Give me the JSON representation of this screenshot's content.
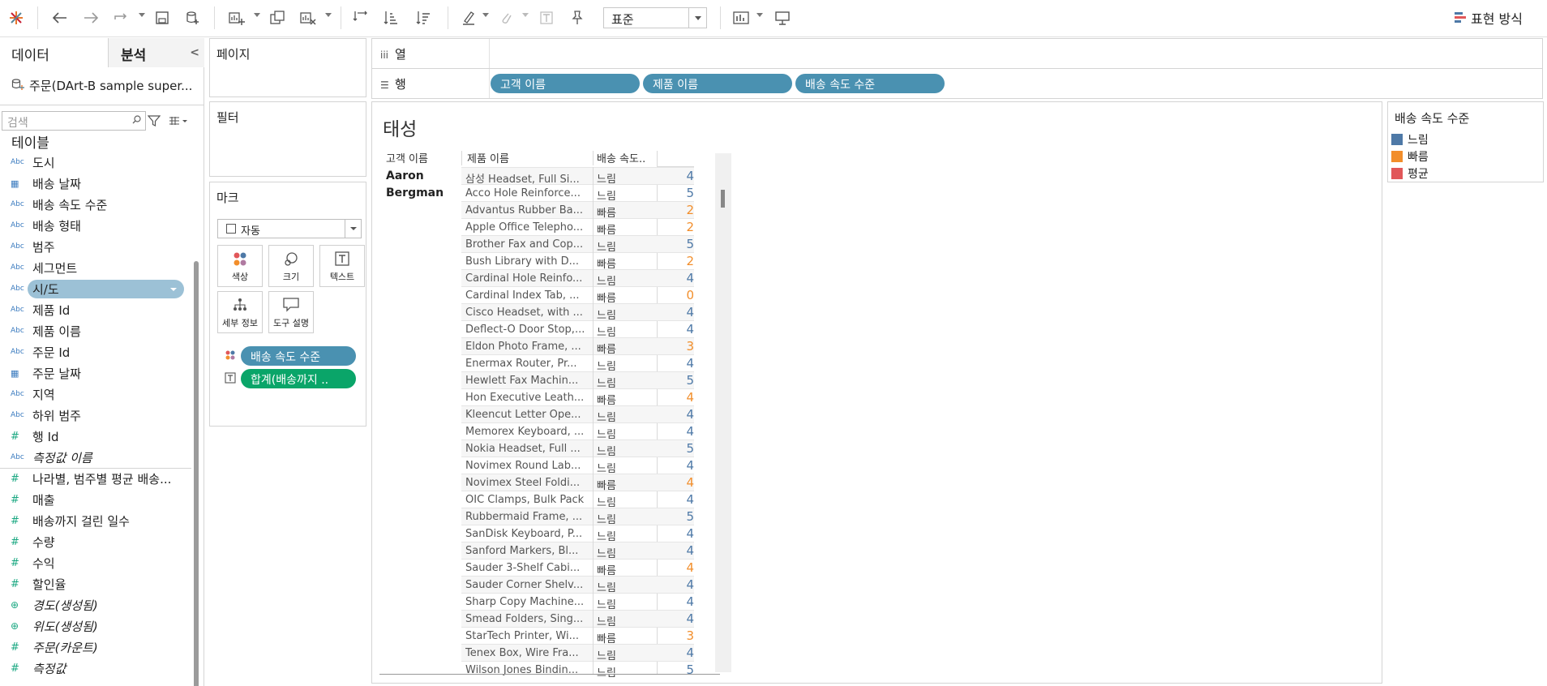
{
  "toolbar": {
    "fit_value": "표준",
    "show_me_label": "표현 방식"
  },
  "data_pane": {
    "tab_data": "데이터",
    "tab_analytics": "분석",
    "datasource_name": "주문(DArt-B sample super...",
    "search_placeholder": "검색",
    "tables_heading": "테이블",
    "fields": [
      {
        "type": "Abc",
        "name": "도시"
      },
      {
        "type": "cal",
        "name": "배송 날짜"
      },
      {
        "type": "Abc",
        "name": "배송 속도 수준"
      },
      {
        "type": "Abc",
        "name": "배송 형태"
      },
      {
        "type": "Abc",
        "name": "범주"
      },
      {
        "type": "Abc",
        "name": "세그먼트"
      },
      {
        "type": "Abc",
        "name": "시/도"
      },
      {
        "type": "Abc",
        "name": "제품 Id"
      },
      {
        "type": "Abc",
        "name": "제품 이름"
      },
      {
        "type": "Abc",
        "name": "주문 Id"
      },
      {
        "type": "cal",
        "name": "주문 날짜"
      },
      {
        "type": "Abc",
        "name": "지역"
      },
      {
        "type": "Abc",
        "name": "하위 범주"
      },
      {
        "type": "#",
        "name": "행 Id"
      },
      {
        "type": "Abc",
        "name": "측정값 이름"
      },
      {
        "type": "#",
        "name": "나라별, 범주별 평균 배송..."
      },
      {
        "type": "#",
        "name": "매출"
      },
      {
        "type": "#",
        "name": "배송까지 걸린 일수"
      },
      {
        "type": "#",
        "name": "수량"
      },
      {
        "type": "#",
        "name": "수익"
      },
      {
        "type": "#",
        "name": "할인율"
      },
      {
        "type": "globe",
        "name": "경도(생성됨)"
      },
      {
        "type": "globe",
        "name": "위도(생성됨)"
      },
      {
        "type": "#",
        "name": "주문(카운트)"
      },
      {
        "type": "#",
        "name": "측정값"
      }
    ]
  },
  "cards": {
    "pages_title": "페이지",
    "filters_title": "필터",
    "marks_title": "마크",
    "marks_type": "자동",
    "mark_buttons": [
      "색상",
      "크기",
      "텍스트",
      "세부 정보",
      "도구 설명"
    ],
    "color_pill": "배송 속도 수준",
    "text_pill": "합계(배송까지 .."
  },
  "shelves": {
    "columns_label": "열",
    "rows_label": "행",
    "row_pills": [
      "고객 이름",
      "제품 이름",
      "배송 속도 수준"
    ]
  },
  "view": {
    "sheet_title": "태성",
    "headers": [
      "고객 이름",
      "제품 이름",
      "배송 속도.."
    ],
    "customer_first": "Aaron",
    "customer_last": "Bergman",
    "rows": [
      {
        "product": "삼성 Headset, Full Si...",
        "speed": "느림",
        "days": "4"
      },
      {
        "product": "Acco Hole Reinforce...",
        "speed": "느림",
        "days": "5"
      },
      {
        "product": "Advantus Rubber Ba...",
        "speed": "빠름",
        "days": "2"
      },
      {
        "product": "Apple Office Telepho...",
        "speed": "빠름",
        "days": "2"
      },
      {
        "product": "Brother Fax and Cop...",
        "speed": "느림",
        "days": "5"
      },
      {
        "product": "Bush Library with D...",
        "speed": "빠름",
        "days": "2"
      },
      {
        "product": "Cardinal Hole Reinfo...",
        "speed": "느림",
        "days": "4"
      },
      {
        "product": "Cardinal Index Tab, ...",
        "speed": "빠름",
        "days": "0"
      },
      {
        "product": "Cisco Headset, with ...",
        "speed": "느림",
        "days": "4"
      },
      {
        "product": "Deflect-O Door Stop,...",
        "speed": "느림",
        "days": "4"
      },
      {
        "product": "Eldon Photo Frame, ...",
        "speed": "빠름",
        "days": "3"
      },
      {
        "product": "Enermax Router, Pr...",
        "speed": "느림",
        "days": "4"
      },
      {
        "product": "Hewlett Fax Machin...",
        "speed": "느림",
        "days": "5"
      },
      {
        "product": "Hon Executive Leath...",
        "speed": "빠름",
        "days": "4"
      },
      {
        "product": "Kleencut Letter Ope...",
        "speed": "느림",
        "days": "4"
      },
      {
        "product": "Memorex Keyboard, ...",
        "speed": "느림",
        "days": "4"
      },
      {
        "product": "Nokia Headset, Full ...",
        "speed": "느림",
        "days": "5"
      },
      {
        "product": "Novimex Round Lab...",
        "speed": "느림",
        "days": "4"
      },
      {
        "product": "Novimex Steel Foldi...",
        "speed": "빠름",
        "days": "4"
      },
      {
        "product": "OIC Clamps, Bulk Pack",
        "speed": "느림",
        "days": "4"
      },
      {
        "product": "Rubbermaid Frame, ...",
        "speed": "느림",
        "days": "5"
      },
      {
        "product": "SanDisk Keyboard, P...",
        "speed": "느림",
        "days": "4"
      },
      {
        "product": "Sanford Markers, Bl...",
        "speed": "느림",
        "days": "4"
      },
      {
        "product": "Sauder 3-Shelf Cabi...",
        "speed": "빠름",
        "days": "4"
      },
      {
        "product": "Sauder Corner Shelv...",
        "speed": "느림",
        "days": "4"
      },
      {
        "product": "Sharp Copy Machine...",
        "speed": "느림",
        "days": "4"
      },
      {
        "product": "Smead Folders, Sing...",
        "speed": "느림",
        "days": "4"
      },
      {
        "product": "StarTech Printer, Wi...",
        "speed": "빠름",
        "days": "3"
      },
      {
        "product": "Tenex Box, Wire Fra...",
        "speed": "느림",
        "days": "4"
      },
      {
        "product": "Wilson Jones Bindin...",
        "speed": "느림",
        "days": "5"
      }
    ]
  },
  "legend": {
    "title": "배송 속도 수준",
    "items": [
      {
        "label": "느림",
        "color": "#4e79a7"
      },
      {
        "label": "빠름",
        "color": "#f28e2b"
      },
      {
        "label": "평균",
        "color": "#e15759"
      }
    ]
  },
  "colors": {
    "slow": "#4e79a7",
    "fast": "#f28e2b",
    "pill_blue": "#4a91b1",
    "pill_green": "#0aa569"
  }
}
